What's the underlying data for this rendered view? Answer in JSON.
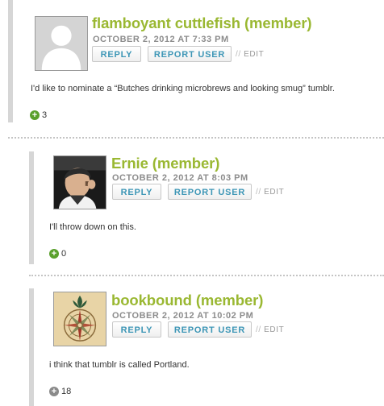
{
  "comments": [
    {
      "name": "flamboyant cuttlefish (member)",
      "date": "OCTOBER 2, 2012 AT 7:33 PM",
      "reply_label": "REPLY",
      "report_label": "REPORT USER",
      "edit_sep": "//",
      "edit_label": "EDIT",
      "text": "I'd like to nominate a “Butches drinking microbrews and looking smug” tumblr.",
      "votes": "3",
      "vote_color": "#5aa02c",
      "avatar": "default-silhouette"
    },
    {
      "name": "Ernie (member)",
      "date": "OCTOBER 2, 2012 AT 8:03 PM",
      "reply_label": "REPLY",
      "report_label": "REPORT USER",
      "edit_sep": "//",
      "edit_label": "EDIT",
      "text": "I'll throw down on this.",
      "votes": "0",
      "vote_color": "#5aa02c",
      "avatar": "person-photo"
    },
    {
      "name": "bookbound (member)",
      "date": "OCTOBER 2, 2012 AT 10:02 PM",
      "reply_label": "REPLY",
      "report_label": "REPORT USER",
      "edit_sep": "//",
      "edit_label": "EDIT",
      "text": "i think that tumblr is called Portland.",
      "votes": "18",
      "vote_color": "#8a8a8a",
      "avatar": "compass-rose"
    }
  ]
}
